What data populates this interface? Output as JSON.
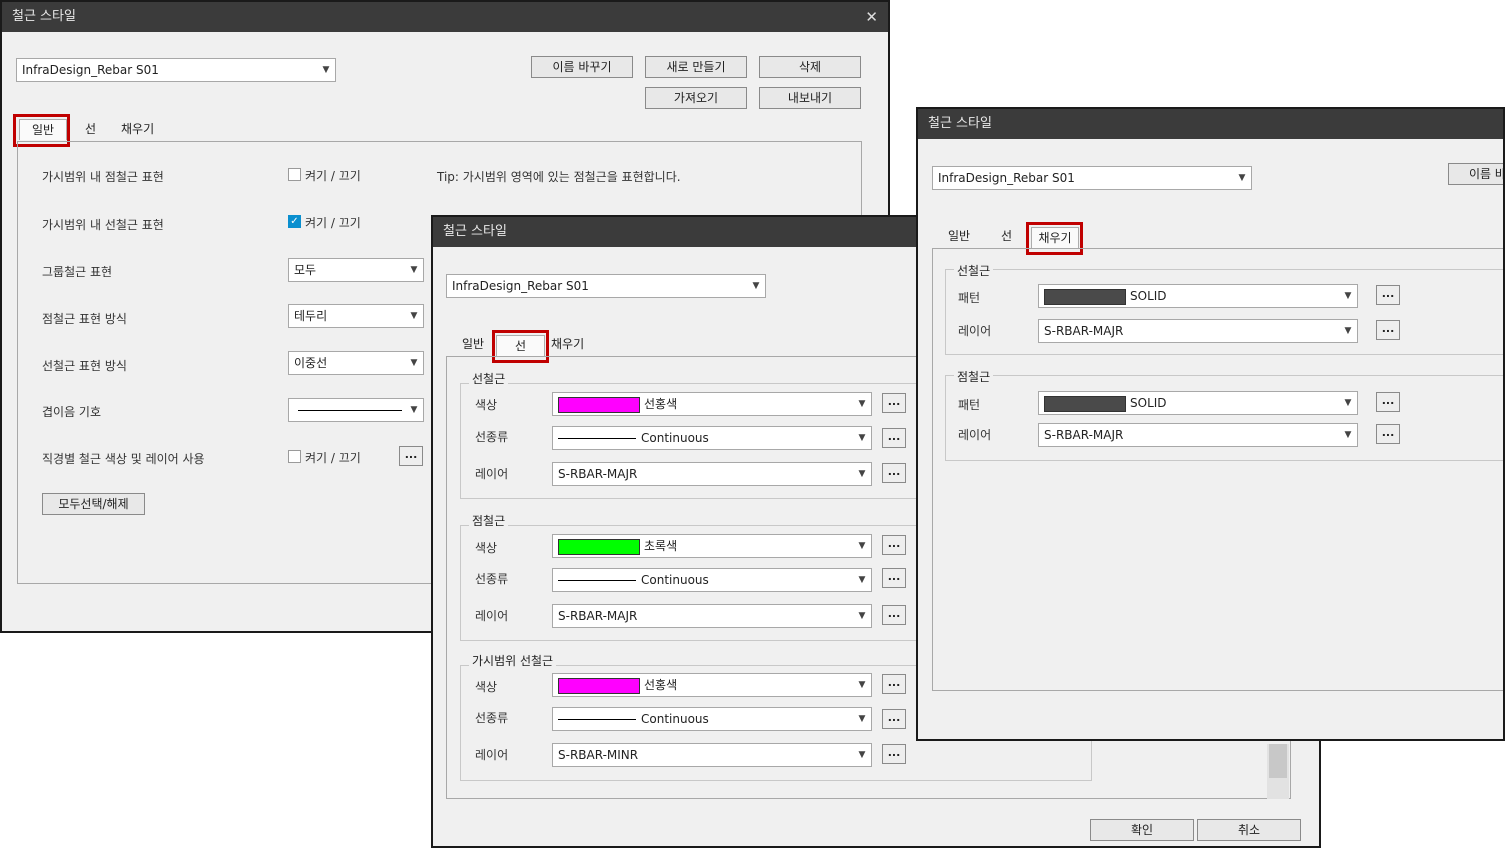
{
  "dialog_title": "철근 스타일",
  "style_name": "InfraDesign_Rebar S01",
  "buttons": {
    "rename": "이름 바꾸기",
    "new": "새로 만들기",
    "delete": "삭제",
    "import": "가져오기",
    "export": "내보내기",
    "rename_partial": "이름 바",
    "ok": "확인",
    "cancel": "취소",
    "select_all": "모두선택/해제",
    "more": "..."
  },
  "tabs": [
    "일반",
    "선",
    "채우기"
  ],
  "general": {
    "rows": [
      {
        "label": "가시범위 내 점철근 표현",
        "control": "checkbox",
        "checked": false,
        "value": "켜기 / 끄기"
      },
      {
        "label": "가시범위 내 선철근 표현",
        "control": "checkbox",
        "checked": true,
        "value": "켜기 / 끄기"
      },
      {
        "label": "그룹철근 표현",
        "control": "combo",
        "value": "모두"
      },
      {
        "label": "점철근 표현 방식",
        "control": "combo",
        "value": "테두리"
      },
      {
        "label": "선철근 표현 방식",
        "control": "combo",
        "value": "이중선"
      },
      {
        "label": "겹이음 기호",
        "control": "combo",
        "value": ""
      },
      {
        "label": "직경별 철근 색상 및 레이어 사용",
        "control": "checkbox",
        "checked": false,
        "value": "켜기 / 끄기"
      }
    ],
    "tip": "Tip: 가시범위 영역에 있는 점철근을 표현합니다."
  },
  "line_tab": {
    "groups": [
      {
        "title": "선철근",
        "color_label": "색상",
        "color_name": "선홍색",
        "color_hex": "#ff00ff",
        "linetype_label": "선종류",
        "linetype": "Continuous",
        "layer_label": "레이어",
        "layer": "S-RBAR-MAJR"
      },
      {
        "title": "점철근",
        "color_label": "색상",
        "color_name": "초록색",
        "color_hex": "#00ff00",
        "linetype_label": "선종류",
        "linetype": "Continuous",
        "layer_label": "레이어",
        "layer": "S-RBAR-MAJR"
      },
      {
        "title": "가시범위 선철근",
        "color_label": "색상",
        "color_name": "선홍색",
        "color_hex": "#ff00ff",
        "linetype_label": "선종류",
        "linetype": "Continuous",
        "layer_label": "레이어",
        "layer": "S-RBAR-MINR"
      }
    ]
  },
  "fill_tab": {
    "groups": [
      {
        "title": "선철근",
        "pattern_label": "패턴",
        "pattern": "SOLID",
        "layer_label": "레이어",
        "layer": "S-RBAR-MAJR"
      },
      {
        "title": "점철근",
        "pattern_label": "패턴",
        "pattern": "SOLID",
        "layer_label": "레이어",
        "layer": "S-RBAR-MAJR"
      }
    ],
    "pattern_swatch_hex": "#4a4a4a"
  },
  "colors": {
    "highlight_red": "#c00000",
    "titlebar": "#3b3b3b",
    "checkbox_accent": "#0a8fcf"
  }
}
